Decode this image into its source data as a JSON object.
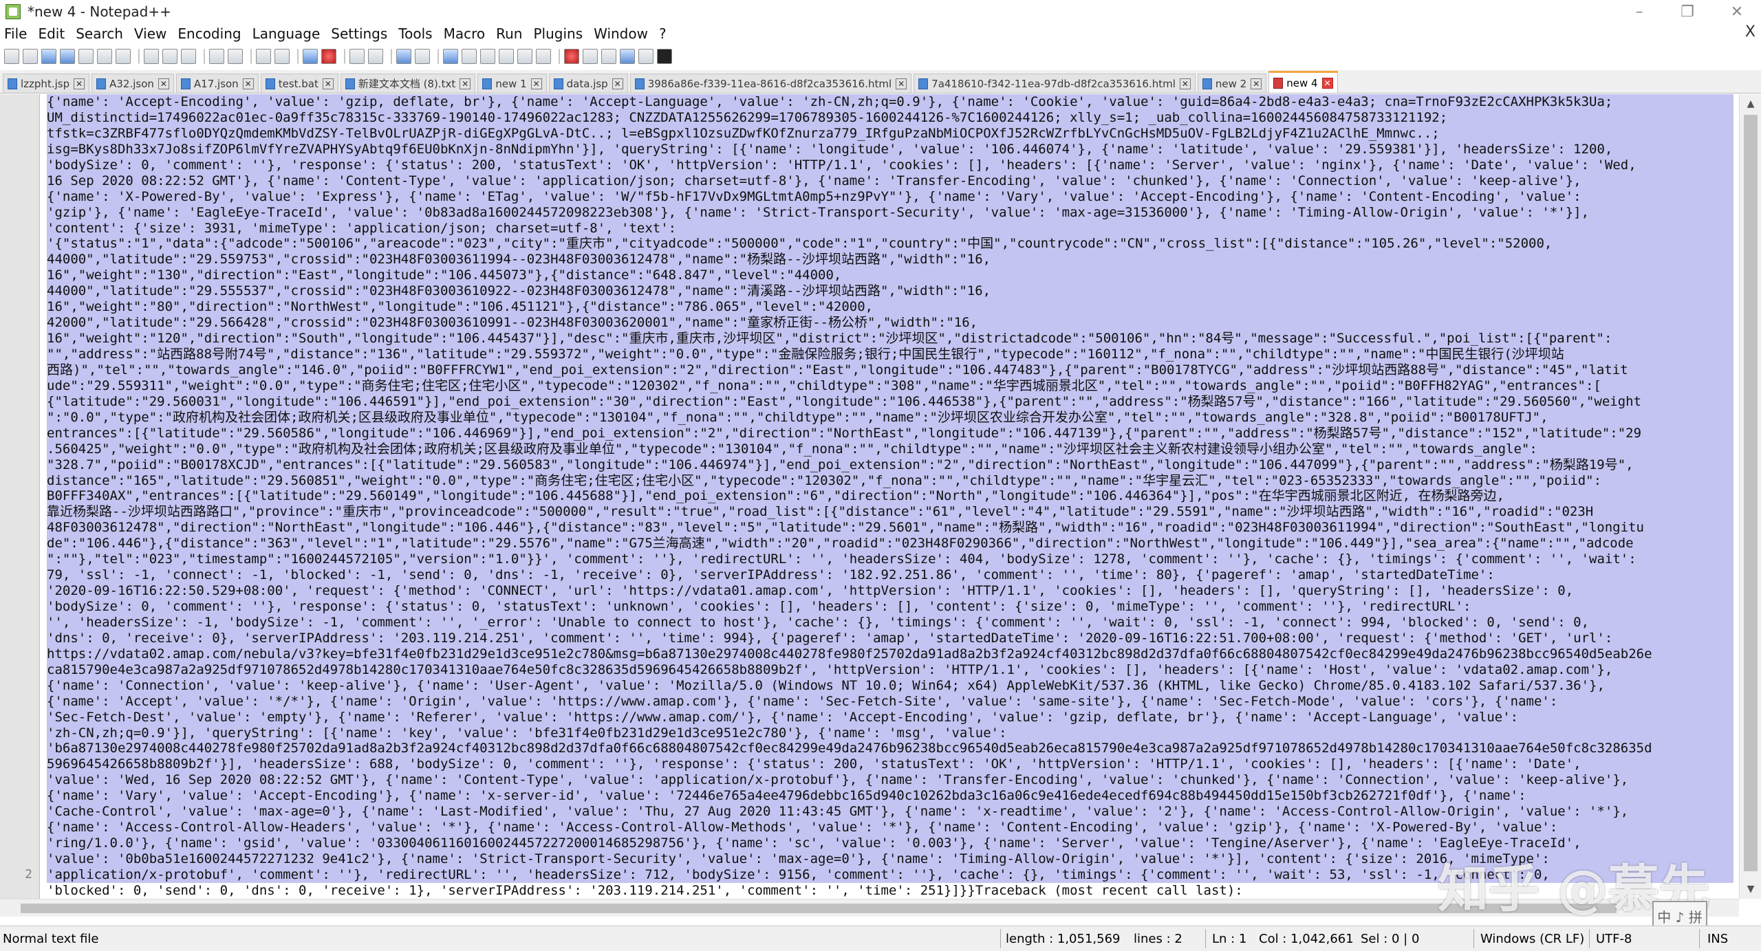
{
  "window": {
    "title": "*new 4 - Notepad++",
    "minimize": "–",
    "restore": "❐",
    "close": "✕"
  },
  "menu": [
    "File",
    "Edit",
    "Search",
    "View",
    "Encoding",
    "Language",
    "Settings",
    "Tools",
    "Macro",
    "Run",
    "Plugins",
    "Window",
    "?"
  ],
  "menu_close": "X",
  "tabs": [
    {
      "label": "lzzpht.jsp",
      "active": false
    },
    {
      "label": "A32.json",
      "active": false
    },
    {
      "label": "A17.json",
      "active": false
    },
    {
      "label": "test.bat",
      "active": false
    },
    {
      "label": "新建文本文档 (8).txt",
      "active": false
    },
    {
      "label": "new 1",
      "active": false
    },
    {
      "label": "data.jsp",
      "active": false
    },
    {
      "label": "3986a86e-f339-11ea-8616-d8f2ca353616.html",
      "active": false
    },
    {
      "label": "7a418610-f342-11ea-97db-d8f2ca353616.html",
      "active": false
    },
    {
      "label": "new 2",
      "active": false
    },
    {
      "label": "new 4",
      "active": true
    }
  ],
  "editor": {
    "line_numbers": [
      "",
      "2"
    ],
    "lines": [
      "{'name': 'Accept-Encoding', 'value': 'gzip, deflate, br'}, {'name': 'Accept-Language', 'value': 'zh-CN,zh;q=0.9'}, {'name': 'Cookie', 'value': 'guid=86a4-2bd8-e4a3-e4a3; cna=TrnoF93zE2cCAXHPK3k5k3Ua;",
      "UM_distinctid=17496022ac01ec-0a9ff35c78315c-333769-190140-17496022ac1283; CNZZDATA1255626299=1706789305-1600244126-%7C1600244126; xlly_s=1; _uab_collina=160024456084758733121192;",
      "tfstk=c3ZRBF477sflo0DYQzQmdemKMbVdZSY-TelBvOLrUAZPjR-diGEgXPgGLvA-DtC..; l=eBSgpxl1OzsuZDwfKOfZnurza779_IRfguPzaNbMiOCPOXfJ52RcWZrfbLYvCnGcHsMD5uOV-FgLB2LdjyF4Z1u2AClhE_Mmnwc..;",
      "isg=BKys8Dh33x7Jo8sifZOP6lmVfYreZVAPHYSyAbtq9f6EU0bKnXjn-8nNdipmYhn'}], 'queryString': [{'name': 'longitude', 'value': '106.446074'}, {'name': 'latitude', 'value': '29.559381'}], 'headersSize': 1200,",
      "'bodySize': 0, 'comment': ''}, 'response': {'status': 200, 'statusText': 'OK', 'httpVersion': 'HTTP/1.1', 'cookies': [], 'headers': [{'name': 'Server', 'value': 'nginx'}, {'name': 'Date', 'value': 'Wed,",
      "16 Sep 2020 08:22:52 GMT'}, {'name': 'Content-Type', 'value': 'application/json; charset=utf-8'}, {'name': 'Transfer-Encoding', 'value': 'chunked'}, {'name': 'Connection', 'value': 'keep-alive'},",
      "{'name': 'X-Powered-By', 'value': 'Express'}, {'name': 'ETag', 'value': 'W/\"f5b-hF17VvDx9MGLtmtA0mp5+nz9PvY\"'}, {'name': 'Vary', 'value': 'Accept-Encoding'}, {'name': 'Content-Encoding', 'value':",
      "'gzip'}, {'name': 'EagleEye-TraceId', 'value': '0b83ad8a1600244572098223eb308'}, {'name': 'Strict-Transport-Security', 'value': 'max-age=31536000'}, {'name': 'Timing-Allow-Origin', 'value': '*'}],",
      "'content': {'size': 3931, 'mimeType': 'application/json; charset=utf-8', 'text':",
      "'{\"status\":\"1\",\"data\":{\"adcode\":\"500106\",\"areacode\":\"023\",\"city\":\"重庆市\",\"cityadcode\":\"500000\",\"code\":\"1\",\"country\":\"中国\",\"countrycode\":\"CN\",\"cross_list\":[{\"distance\":\"105.26\",\"level\":\"52000,",
      "44000\",\"latitude\":\"29.559753\",\"crossid\":\"023H48F03003611994--023H48F03003612478\",\"name\":\"杨梨路--沙坪坝站西路\",\"width\":\"16,",
      "16\",\"weight\":\"130\",\"direction\":\"East\",\"longitude\":\"106.445073\"},{\"distance\":\"648.847\",\"level\":\"44000,",
      "44000\",\"latitude\":\"29.555537\",\"crossid\":\"023H48F03003610922--023H48F03003612478\",\"name\":\"清溪路--沙坪坝站西路\",\"width\":\"16,",
      "16\",\"weight\":\"80\",\"direction\":\"NorthWest\",\"longitude\":\"106.451121\"},{\"distance\":\"786.065\",\"level\":\"42000,",
      "42000\",\"latitude\":\"29.566428\",\"crossid\":\"023H48F03003610991--023H48F03003620001\",\"name\":\"童家桥正街--杨公桥\",\"width\":\"16,",
      "16\",\"weight\":\"120\",\"direction\":\"South\",\"longitude\":\"106.445437\"}],\"desc\":\"重庆市,重庆市,沙坪坝区\",\"district\":\"沙坪坝区\",\"districtadcode\":\"500106\",\"hn\":\"84号\",\"message\":\"Successful.\",\"poi_list\":[{\"parent\":",
      "\"\",\"address\":\"站西路88号附74号\",\"distance\":\"136\",\"latitude\":\"29.559372\",\"weight\":\"0.0\",\"type\":\"金融保险服务;银行;中国民生银行\",\"typecode\":\"160112\",\"f_nona\":\"\",\"childtype\":\"\",\"name\":\"中国民生银行(沙坪坝站",
      "西路)\",\"tel\":\"\",\"towards_angle\":\"146.0\",\"poiid\":\"B0FFFRCYW1\",\"end_poi_extension\":\"2\",\"direction\":\"East\",\"longitude\":\"106.447483\"},{\"parent\":\"B00178TYCG\",\"address\":\"沙坪坝站西路88号\",\"distance\":\"45\",\"latit",
      "ude\":\"29.559311\",\"weight\":\"0.0\",\"type\":\"商务住宅;住宅区;住宅小区\",\"typecode\":\"120302\",\"f_nona\":\"\",\"childtype\":\"308\",\"name\":\"华宇西城丽景北区\",\"tel\":\"\",\"towards_angle\":\"\",\"poiid\":\"B0FFH82YAG\",\"entrances\":[",
      "{\"latitude\":\"29.560031\",\"longitude\":\"106.446591\"}],\"end_poi_extension\":\"30\",\"direction\":\"East\",\"longitude\":\"106.446538\"},{\"parent\":\"\",\"address\":\"杨梨路57号\",\"distance\":\"166\",\"latitude\":\"29.560560\",\"weight",
      "\":\"0.0\",\"type\":\"政府机构及社会团体;政府机关;区县级政府及事业单位\",\"typecode\":\"130104\",\"f_nona\":\"\",\"childtype\":\"\",\"name\":\"沙坪坝区农业综合开发办公室\",\"tel\":\"\",\"towards_angle\":\"328.8\",\"poiid\":\"B00178UFTJ\",",
      "entrances\":[{\"latitude\":\"29.560586\",\"longitude\":\"106.446969\"}],\"end_poi_extension\":\"2\",\"direction\":\"NorthEast\",\"longitude\":\"106.447139\"},{\"parent\":\"\",\"address\":\"杨梨路57号\",\"distance\":\"152\",\"latitude\":\"29",
      ".560425\",\"weight\":\"0.0\",\"type\":\"政府机构及社会团体;政府机关;区县级政府及事业单位\",\"typecode\":\"130104\",\"f_nona\":\"\",\"childtype\":\"\",\"name\":\"沙坪坝区社会主义新农村建设领导小组办公室\",\"tel\":\"\",\"towards_angle\":",
      "\"328.7\",\"poiid\":\"B00178XCJD\",\"entrances\":[{\"latitude\":\"29.560583\",\"longitude\":\"106.446974\"}],\"end_poi_extension\":\"2\",\"direction\":\"NorthEast\",\"longitude\":\"106.447099\"},{\"parent\":\"\",\"address\":\"杨梨路19号\",",
      "distance\":\"165\",\"latitude\":\"29.560851\",\"weight\":\"0.0\",\"type\":\"商务住宅;住宅区;住宅小区\",\"typecode\":\"120302\",\"f_nona\":\"\",\"childtype\":\"\",\"name\":\"华宇星云汇\",\"tel\":\"023-65352333\",\"towards_angle\":\"\",\"poiid\":",
      "B0FFF340AX\",\"entrances\":[{\"latitude\":\"29.560149\",\"longitude\":\"106.445688\"}],\"end_poi_extension\":\"6\",\"direction\":\"North\",\"longitude\":\"106.446364\"}],\"pos\":\"在华宇西城丽景北区附近, 在杨梨路旁边,",
      "靠近杨梨路--沙坪坝站西路路口\",\"province\":\"重庆市\",\"provinceadcode\":\"500000\",\"result\":\"true\",\"road_list\":[{\"distance\":\"61\",\"level\":\"4\",\"latitude\":\"29.5591\",\"name\":\"沙坪坝站西路\",\"width\":\"16\",\"roadid\":\"023H",
      "48F03003612478\",\"direction\":\"NorthEast\",\"longitude\":\"106.446\"},{\"distance\":\"83\",\"level\":\"5\",\"latitude\":\"29.5601\",\"name\":\"杨梨路\",\"width\":\"16\",\"roadid\":\"023H48F03003611994\",\"direction\":\"SouthEast\",\"longitu",
      "de\":\"106.446\"},{\"distance\":\"363\",\"level\":\"1\",\"latitude\":\"29.5576\",\"name\":\"G75兰海高速\",\"width\":\"20\",\"roadid\":\"023H48F0290366\",\"direction\":\"NorthWest\",\"longitude\":\"106.449\"}],\"sea_area\":{\"name\":\"\",\"adcode",
      "\":\"\"},\"tel\":\"023\",\"timestamp\":\"1600244572105\",\"version\":\"1.0\"}}', 'comment': ''}, 'redirectURL': '', 'headersSize': 404, 'bodySize': 1278, 'comment': ''}, 'cache': {}, 'timings': {'comment': '', 'wait':",
      "79, 'ssl': -1, 'connect': -1, 'blocked': -1, 'send': 0, 'dns': -1, 'receive': 0}, 'serverIPAddress': '182.92.251.86', 'comment': '', 'time': 80}, {'pageref': 'amap', 'startedDateTime':",
      "'2020-09-16T16:22:50.529+08:00', 'request': {'method': 'CONNECT', 'url': 'https://vdata01.amap.com', 'httpVersion': 'HTTP/1.1', 'cookies': [], 'headers': [], 'queryString': [], 'headersSize': 0,",
      "'bodySize': 0, 'comment': ''}, 'response': {'status': 0, 'statusText': 'unknown', 'cookies': [], 'headers': [], 'content': {'size': 0, 'mimeType': '', 'comment': ''}, 'redirectURL':",
      "'', 'headersSize': -1, 'bodySize': -1, 'comment': '', '_error': 'Unable to connect to host'}, 'cache': {}, 'timings': {'comment': '', 'wait': 0, 'ssl': -1, 'connect': 994, 'blocked': 0, 'send': 0,",
      "'dns': 0, 'receive': 0}, 'serverIPAddress': '203.119.214.251', 'comment': '', 'time': 994}, {'pageref': 'amap', 'startedDateTime': '2020-09-16T16:22:51.700+08:00', 'request': {'method': 'GET', 'url':",
      "https://vdata02.amap.com/nebula/v3?key=bfe31f4e0fb231d29e1d3ce951e2c780&msg=b6a87130e2974008c440278fe980f25702da91ad8a2b3f2a924cf40312bc898d2d37dfa0f66c68804807542cf0ec84299e49da2476b96238bcc96540d5eab26e",
      "ca815790e4e3ca987a2a925df971078652d4978b14280c170341310aae764e50fc8c328635d5969645426658b8809b2f', 'httpVersion': 'HTTP/1.1', 'cookies': [], 'headers': [{'name': 'Host', 'value': 'vdata02.amap.com'},",
      "{'name': 'Connection', 'value': 'keep-alive'}, {'name': 'User-Agent', 'value': 'Mozilla/5.0 (Windows NT 10.0; Win64; x64) AppleWebKit/537.36 (KHTML, like Gecko) Chrome/85.0.4183.102 Safari/537.36'},",
      "{'name': 'Accept', 'value': '*/*'}, {'name': 'Origin', 'value': 'https://www.amap.com'}, {'name': 'Sec-Fetch-Site', 'value': 'same-site'}, {'name': 'Sec-Fetch-Mode', 'value': 'cors'}, {'name':",
      "'Sec-Fetch-Dest', 'value': 'empty'}, {'name': 'Referer', 'value': 'https://www.amap.com/'}, {'name': 'Accept-Encoding', 'value': 'gzip, deflate, br'}, {'name': 'Accept-Language', 'value':",
      "'zh-CN,zh;q=0.9'}], 'queryString': [{'name': 'key', 'value': 'bfe31f4e0fb231d29e1d3ce951e2c780'}, {'name': 'msg', 'value':",
      "'b6a87130e2974008c440278fe980f25702da91ad8a2b3f2a924cf40312bc898d2d37dfa0f66c68804807542cf0ec84299e49da2476b96238bcc96540d5eab26eca815790e4e3ca987a2a925df971078652d4978b14280c170341310aae764e50fc8c328635d",
      "5969645426658b8809b2f'}], 'headersSize': 688, 'bodySize': 0, 'comment': ''}, 'response': {'status': 200, 'statusText': 'OK', 'httpVersion': 'HTTP/1.1', 'cookies': [], 'headers': [{'name': 'Date',",
      "'value': 'Wed, 16 Sep 2020 08:22:52 GMT'}, {'name': 'Content-Type', 'value': 'application/x-protobuf'}, {'name': 'Transfer-Encoding', 'value': 'chunked'}, {'name': 'Connection', 'value': 'keep-alive'},",
      "{'name': 'Vary', 'value': 'Accept-Encoding'}, {'name': 'x-server-id', 'value': '72446e765a4ee4796debbc165d940c10262bda3c16a06c9e416ede4ecedf694c88b494450dd15e150bf3cb262721f0df'}, {'name':",
      "'Cache-Control', 'value': 'max-age=0'}, {'name': 'Last-Modified', 'value': 'Thu, 27 Aug 2020 11:43:45 GMT'}, {'name': 'x-readtime', 'value': '2'}, {'name': 'Access-Control-Allow-Origin', 'value': '*'},",
      "{'name': 'Access-Control-Allow-Headers', 'value': '*'}, {'name': 'Access-Control-Allow-Methods', 'value': '*'}, {'name': 'Content-Encoding', 'value': 'gzip'}, {'name': 'X-Powered-By', 'value':",
      "'ring/1.0.0'}, {'name': 'gsid', 'value': '033004061160160024457227200014685298756'}, {'name': 'sc', 'value': '0.003'}, {'name': 'Server', 'value': 'Tengine/Aserver'}, {'name': 'EagleEye-TraceId',",
      "'value': '0b0ba51e1600244572271232 9e41c2'}, {'name': 'Strict-Transport-Security', 'value': 'max-age=0'}, {'name': 'Timing-Allow-Origin', 'value': '*'}], 'content': {'size': 2016, 'mimeType':",
      "'application/x-protobuf', 'comment': ''}, 'redirectURL': '', 'headersSize': 712, 'bodySize': 9156, 'comment': ''}, 'cache': {}, 'timings': {'comment': '', 'wait': 53, 'ssl': -1, 'connect': 0,",
      "'blocked': 0, 'send': 0, 'dns': 0, 'receive': 1}, 'serverIPAddress': '203.119.214.251', 'comment': '', 'time': 251}]}}Traceback (most recent call last):"
    ]
  },
  "status": {
    "file_type": "Normal text file",
    "length": "length : 1,051,569",
    "lines": "lines : 2",
    "ln": "Ln : 1",
    "col": "Col : 1,042,661",
    "sel": "Sel : 0 | 0",
    "eol": "Windows (CR LF)",
    "encoding": "UTF-8",
    "ins": "INS"
  },
  "watermark": "知乎 @慕先",
  "stamp": "中 ♪ 拼"
}
